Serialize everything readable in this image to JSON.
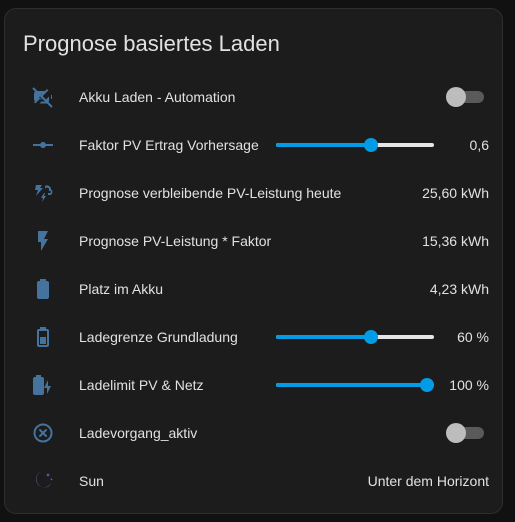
{
  "card": {
    "title": "Prognose basiertes Laden"
  },
  "colors": {
    "icon": "#44739e",
    "accent": "#039be5",
    "sun_icon": "#5c6bc0"
  },
  "rows": [
    {
      "icon": "battery-charging-off-icon",
      "label": "Akku Laden - Automation",
      "control": "toggle",
      "state": "off"
    },
    {
      "icon": "ray-vertex-icon",
      "label": "Faktor PV Ertrag Vorhersage",
      "control": "slider",
      "fraction": 0.6,
      "value": "0,6"
    },
    {
      "icon": "weather-partly-lightning-icon",
      "label": "Prognose verbleibende PV-Leistung heute",
      "value": "25,60 kWh"
    },
    {
      "icon": "flash-icon",
      "label": "Prognose PV-Leistung * Faktor",
      "value": "15,36 kWh"
    },
    {
      "icon": "battery-icon",
      "label": "Platz im Akku",
      "value": "4,23 kWh"
    },
    {
      "icon": "battery-outline-icon",
      "label": "Ladegrenze Grundladung",
      "control": "slider",
      "fraction": 0.6,
      "value": "60 %"
    },
    {
      "icon": "battery-charging-icon",
      "label": "Ladelimit PV & Netz",
      "control": "slider",
      "fraction": 1.0,
      "value": "100 %"
    },
    {
      "icon": "close-circle-outline-icon",
      "label": "Ladevorgang_aktiv",
      "control": "toggle",
      "state": "off"
    },
    {
      "icon": "weather-night-icon",
      "label": "Sun",
      "value": "Unter dem Horizont"
    }
  ]
}
